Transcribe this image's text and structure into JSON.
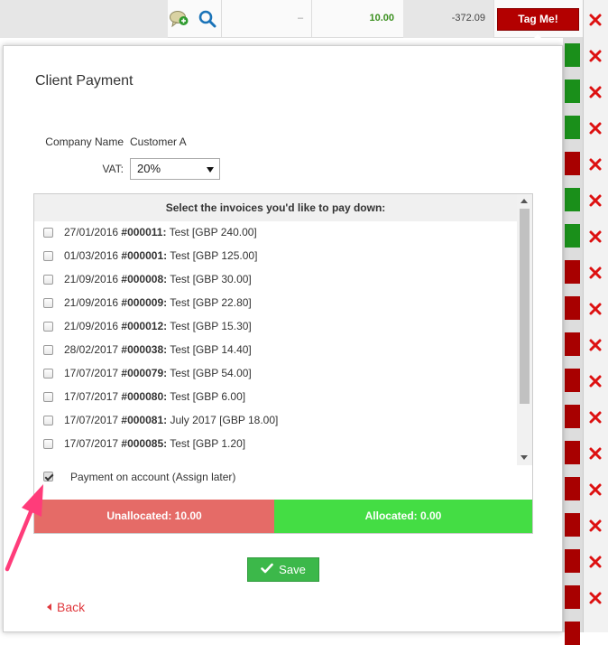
{
  "background_table": {
    "top_row": {
      "placeholder": "–",
      "amount": "10.00",
      "balance": "-372.09",
      "tag_button_label": "Tag Me!"
    },
    "status_squares": [
      "green",
      "green",
      "green",
      "red",
      "green",
      "green",
      "red",
      "red",
      "red",
      "red",
      "red",
      "red",
      "red",
      "red",
      "red",
      "red",
      "red",
      "red",
      "red",
      "red",
      "red",
      "red",
      "green",
      "green"
    ],
    "colors": {
      "green": "#1a8f1a",
      "red": "#a80000"
    },
    "delete_icon": "close-x-icon"
  },
  "modal": {
    "title": "Client Payment",
    "company_name_label": "Company Name",
    "company_name_value": "Customer A",
    "vat_label": "VAT:",
    "vat_selected": "20%",
    "invoice_header": "Select the invoices you'd like to pay down:",
    "invoices": [
      {
        "date": "27/01/2016",
        "number": "#000011:",
        "desc": "Test [GBP 240.00]"
      },
      {
        "date": "01/03/2016",
        "number": "#000001:",
        "desc": "Test [GBP 125.00]"
      },
      {
        "date": "21/09/2016",
        "number": "#000008:",
        "desc": "Test [GBP 30.00]"
      },
      {
        "date": "21/09/2016",
        "number": "#000009:",
        "desc": "Test [GBP 22.80]"
      },
      {
        "date": "21/09/2016",
        "number": "#000012:",
        "desc": "Test [GBP 15.30]"
      },
      {
        "date": "28/02/2017",
        "number": "#000038:",
        "desc": "Test [GBP 14.40]"
      },
      {
        "date": "17/07/2017",
        "number": "#000079:",
        "desc": "Test [GBP 54.00]"
      },
      {
        "date": "17/07/2017",
        "number": "#000080:",
        "desc": "Test [GBP 6.00]"
      },
      {
        "date": "17/07/2017",
        "number": "#000081:",
        "desc": "July 2017 [GBP 18.00]"
      },
      {
        "date": "17/07/2017",
        "number": "#000085:",
        "desc": "Test [GBP 1.20]"
      }
    ],
    "payment_on_account_label": "Payment on account (Assign later)",
    "payment_on_account_checked": true,
    "unallocated_label": "Unallocated: 10.00",
    "allocated_label": "Allocated: 0.00",
    "save_label": "Save",
    "back_label": "Back",
    "colors": {
      "unallocated": "#e56b67",
      "allocated": "#44dd44",
      "save": "#3cb84a",
      "back": "#e0393e",
      "annotation_arrow": "#ff3c7a"
    }
  }
}
